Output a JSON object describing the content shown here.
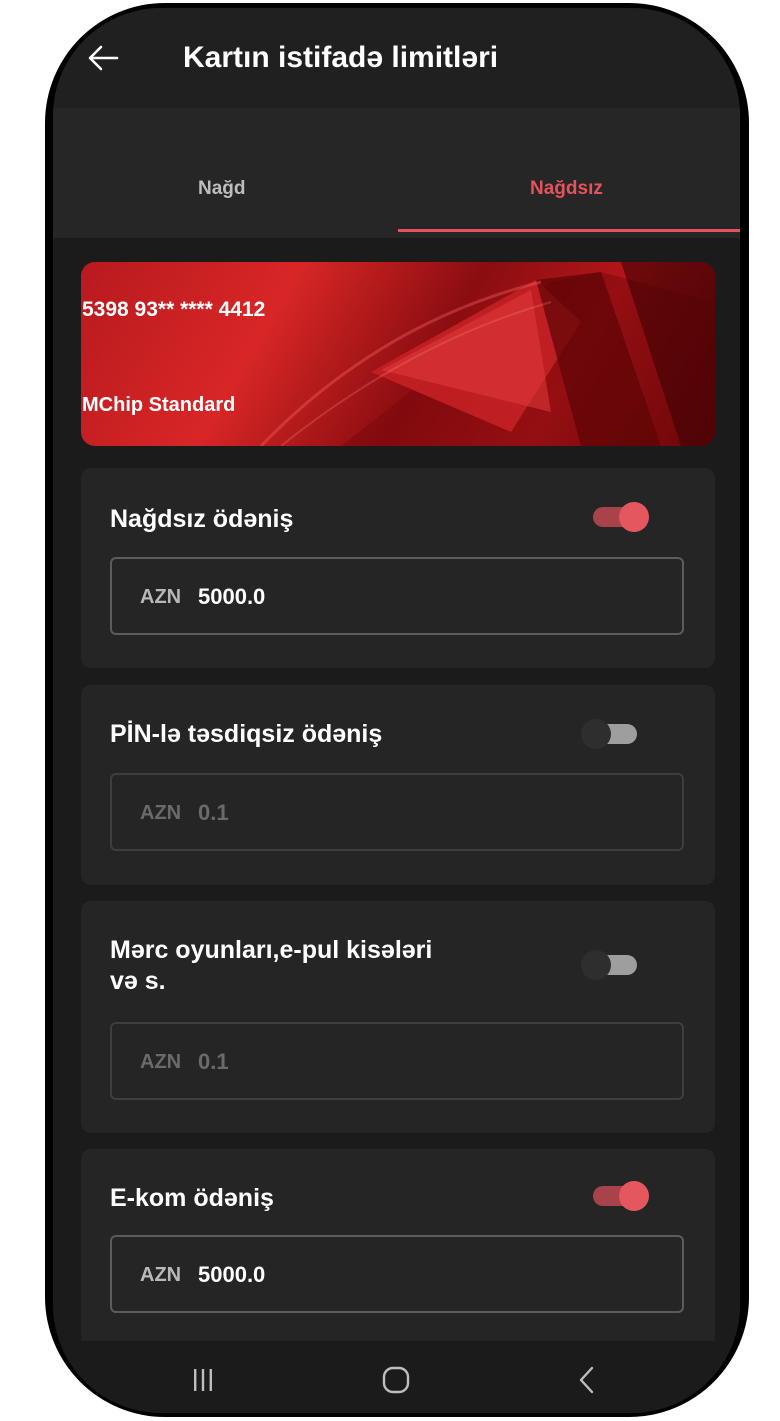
{
  "header": {
    "title": "Kartın istifadə limitləri"
  },
  "tabs": [
    {
      "label": "Nağd",
      "active": false
    },
    {
      "label": "Nağdsız",
      "active": true
    }
  ],
  "card": {
    "number": "5398 93** **** 4412",
    "type": "MChip Standard"
  },
  "limits": [
    {
      "title": "Nağdsız ödəniş",
      "enabled": true,
      "currency": "AZN",
      "amount": "5000.0"
    },
    {
      "title": "PİN-lə təsdiqsiz ödəniş",
      "enabled": false,
      "currency": "AZN",
      "amount": "0.1"
    },
    {
      "title_line1": "Mərc oyunları,e-pul kisələri",
      "title_line2": "və s.",
      "enabled": false,
      "currency": "AZN",
      "amount": "0.1"
    },
    {
      "title": "E-kom ödəniş",
      "enabled": true,
      "currency": "AZN",
      "amount": "5000.0"
    }
  ],
  "colors": {
    "accent": "#e5525a",
    "background": "#1b1b1b",
    "panel": "#252525"
  },
  "icons": {
    "back": "arrow-left-icon",
    "nav_recents": "recent-apps-icon",
    "nav_home": "home-icon",
    "nav_back": "chevron-left-icon"
  }
}
